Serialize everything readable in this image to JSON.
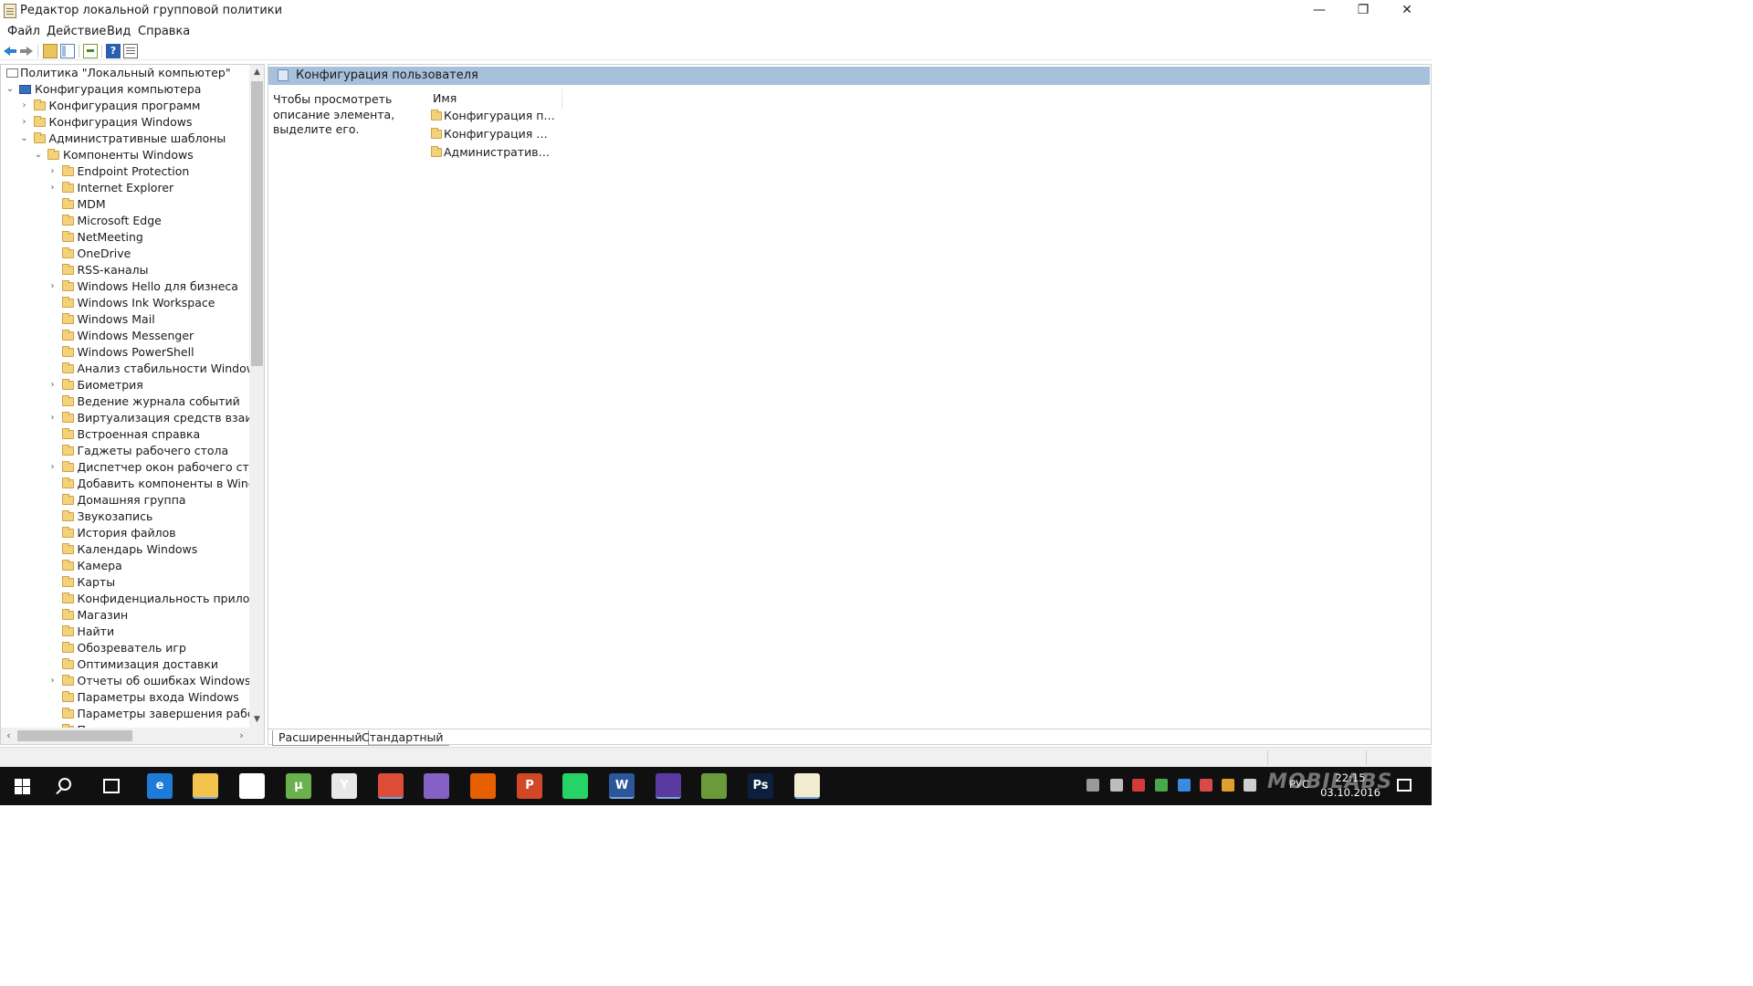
{
  "window": {
    "title": "Редактор локальной групповой политики",
    "minimize_glyph": "—",
    "maximize_glyph": "❐",
    "close_glyph": "✕"
  },
  "menu": {
    "items": [
      "Файл",
      "Действие",
      "Вид",
      "Справка"
    ]
  },
  "toolbar": {
    "icons": [
      "back-arrow-icon",
      "forward-arrow-icon",
      "up-folder-icon",
      "show-hide-tree-icon",
      "export-list-icon",
      "help-icon",
      "properties-icon"
    ],
    "help_glyph": "?"
  },
  "tree": {
    "nodes": [
      {
        "label": "Политика \"Локальный компьютер\"",
        "level": 0,
        "expander": "none",
        "icon": "policy-document-icon"
      },
      {
        "label": "Конфигурация компьютера",
        "level": 0,
        "expander": "expanded",
        "icon": "computer-icon"
      },
      {
        "label": "Конфигурация программ",
        "level": 1,
        "expander": "collapsed",
        "icon": "folder-icon"
      },
      {
        "label": "Конфигурация Windows",
        "level": 1,
        "expander": "collapsed",
        "icon": "folder-icon"
      },
      {
        "label": "Административные шаблоны",
        "level": 1,
        "expander": "expanded",
        "icon": "folder-icon"
      },
      {
        "label": "Компоненты Windows",
        "level": 2,
        "expander": "expanded",
        "icon": "folder-icon"
      },
      {
        "label": "Endpoint Protection",
        "level": 3,
        "expander": "collapsed",
        "icon": "folder-icon"
      },
      {
        "label": "Internet Explorer",
        "level": 3,
        "expander": "collapsed",
        "icon": "folder-icon"
      },
      {
        "label": "MDM",
        "level": 3,
        "expander": "none",
        "icon": "folder-icon"
      },
      {
        "label": "Microsoft Edge",
        "level": 3,
        "expander": "none",
        "icon": "folder-icon"
      },
      {
        "label": "NetMeeting",
        "level": 3,
        "expander": "none",
        "icon": "folder-icon"
      },
      {
        "label": "OneDrive",
        "level": 3,
        "expander": "none",
        "icon": "folder-icon"
      },
      {
        "label": "RSS-каналы",
        "level": 3,
        "expander": "none",
        "icon": "folder-icon"
      },
      {
        "label": "Windows Hello для бизнеса",
        "level": 3,
        "expander": "collapsed",
        "icon": "folder-icon"
      },
      {
        "label": "Windows Ink Workspace",
        "level": 3,
        "expander": "none",
        "icon": "folder-icon"
      },
      {
        "label": "Windows Mail",
        "level": 3,
        "expander": "none",
        "icon": "folder-icon"
      },
      {
        "label": "Windows Messenger",
        "level": 3,
        "expander": "none",
        "icon": "folder-icon"
      },
      {
        "label": "Windows PowerShell",
        "level": 3,
        "expander": "none",
        "icon": "folder-icon"
      },
      {
        "label": "Анализ стабильности Windows",
        "level": 3,
        "expander": "none",
        "icon": "folder-icon"
      },
      {
        "label": "Биометрия",
        "level": 3,
        "expander": "collapsed",
        "icon": "folder-icon"
      },
      {
        "label": "Ведение журнала событий",
        "level": 3,
        "expander": "none",
        "icon": "folder-icon"
      },
      {
        "label": "Виртуализация средств взаимоде",
        "level": 3,
        "expander": "collapsed",
        "icon": "folder-icon"
      },
      {
        "label": "Встроенная справка",
        "level": 3,
        "expander": "none",
        "icon": "folder-icon"
      },
      {
        "label": "Гаджеты рабочего стола",
        "level": 3,
        "expander": "none",
        "icon": "folder-icon"
      },
      {
        "label": "Диспетчер окон рабочего стола",
        "level": 3,
        "expander": "collapsed",
        "icon": "folder-icon"
      },
      {
        "label": "Добавить компоненты в Window",
        "level": 3,
        "expander": "none",
        "icon": "folder-icon"
      },
      {
        "label": "Домашняя группа",
        "level": 3,
        "expander": "none",
        "icon": "folder-icon"
      },
      {
        "label": "Звукозапись",
        "level": 3,
        "expander": "none",
        "icon": "folder-icon"
      },
      {
        "label": "История файлов",
        "level": 3,
        "expander": "none",
        "icon": "folder-icon"
      },
      {
        "label": "Календарь Windows",
        "level": 3,
        "expander": "none",
        "icon": "folder-icon"
      },
      {
        "label": "Камера",
        "level": 3,
        "expander": "none",
        "icon": "folder-icon"
      },
      {
        "label": "Карты",
        "level": 3,
        "expander": "none",
        "icon": "folder-icon"
      },
      {
        "label": "Конфиденциальность приложени",
        "level": 3,
        "expander": "none",
        "icon": "folder-icon"
      },
      {
        "label": "Магазин",
        "level": 3,
        "expander": "none",
        "icon": "folder-icon"
      },
      {
        "label": "Найти",
        "level": 3,
        "expander": "none",
        "icon": "folder-icon"
      },
      {
        "label": "Обозреватель игр",
        "level": 3,
        "expander": "none",
        "icon": "folder-icon"
      },
      {
        "label": "Оптимизация доставки",
        "level": 3,
        "expander": "none",
        "icon": "folder-icon"
      },
      {
        "label": "Отчеты об ошибках Windows",
        "level": 3,
        "expander": "collapsed",
        "icon": "folder-icon"
      },
      {
        "label": "Параметры входа Windows",
        "level": 3,
        "expander": "none",
        "icon": "folder-icon"
      },
      {
        "label": "Параметры завершения работы",
        "level": 3,
        "expander": "none",
        "icon": "folder-icon"
      },
      {
        "label": "Параметры презентации",
        "level": 3,
        "expander": "none",
        "icon": "folder-icon"
      }
    ]
  },
  "details": {
    "header_title": "Конфигурация пользователя",
    "description": "Чтобы просмотреть описание элемента, выделите его.",
    "column_name": "Имя",
    "items": [
      "Конфигурация программ",
      "Конфигурация Windows",
      "Административные шаблоны"
    ],
    "tabs": [
      "Расширенный",
      "Стандартный"
    ],
    "header_color": "#a7c0dc"
  },
  "taskbar": {
    "apps": [
      {
        "name": "edge-icon",
        "color": "#1e7bd7",
        "glyph": "e",
        "active": false
      },
      {
        "name": "file-explorer-icon",
        "color": "#f2c44e",
        "glyph": "",
        "active": true
      },
      {
        "name": "store-icon",
        "color": "#ffffff",
        "glyph": "",
        "active": false
      },
      {
        "name": "utorrent-icon",
        "color": "#6ab04c",
        "glyph": "µ",
        "active": false
      },
      {
        "name": "yandex-browser-icon",
        "color": "#e8e8e8",
        "glyph": "Y",
        "active": false
      },
      {
        "name": "chrome-icon",
        "color": "#dd4b39",
        "glyph": "",
        "active": true
      },
      {
        "name": "visual-studio-icon",
        "color": "#8661c5",
        "glyph": "",
        "active": false
      },
      {
        "name": "firefox-icon",
        "color": "#e66000",
        "glyph": "",
        "active": false
      },
      {
        "name": "powerpoint-icon",
        "color": "#d24726",
        "glyph": "P",
        "active": false
      },
      {
        "name": "whatsapp-icon",
        "color": "#25d366",
        "glyph": "",
        "active": false
      },
      {
        "name": "word-icon",
        "color": "#2b579a",
        "glyph": "W",
        "active": true
      },
      {
        "name": "cpu-app-icon",
        "color": "#5a3aa0",
        "glyph": "",
        "active": true
      },
      {
        "name": "media-app-icon",
        "color": "#6a9a3a",
        "glyph": "",
        "active": false
      },
      {
        "name": "photoshop-icon",
        "color": "#0c1f3f",
        "glyph": "Ps",
        "active": false
      },
      {
        "name": "group-policy-editor-icon",
        "color": "#f3ecd0",
        "glyph": "",
        "active": true
      }
    ],
    "tray_icons": [
      {
        "name": "printer-tray-icon",
        "color": "#9a9a9a"
      },
      {
        "name": "usb-tray-icon",
        "color": "#bdbdbd"
      },
      {
        "name": "kaspersky-tray-icon",
        "color": "#d43a3a"
      },
      {
        "name": "network-tray-icon",
        "color": "#4aa84a"
      },
      {
        "name": "onedrive-tray-icon",
        "color": "#3a8ae0"
      },
      {
        "name": "antivirus-tray-icon",
        "color": "#d84a4a"
      },
      {
        "name": "app-tray-icon",
        "color": "#e0a030"
      },
      {
        "name": "volume-tray-icon",
        "color": "#cfcfcf"
      }
    ],
    "lang": "РУС",
    "time": "22:15",
    "date": "03.10.2016",
    "watermark": "MOBILABS"
  }
}
